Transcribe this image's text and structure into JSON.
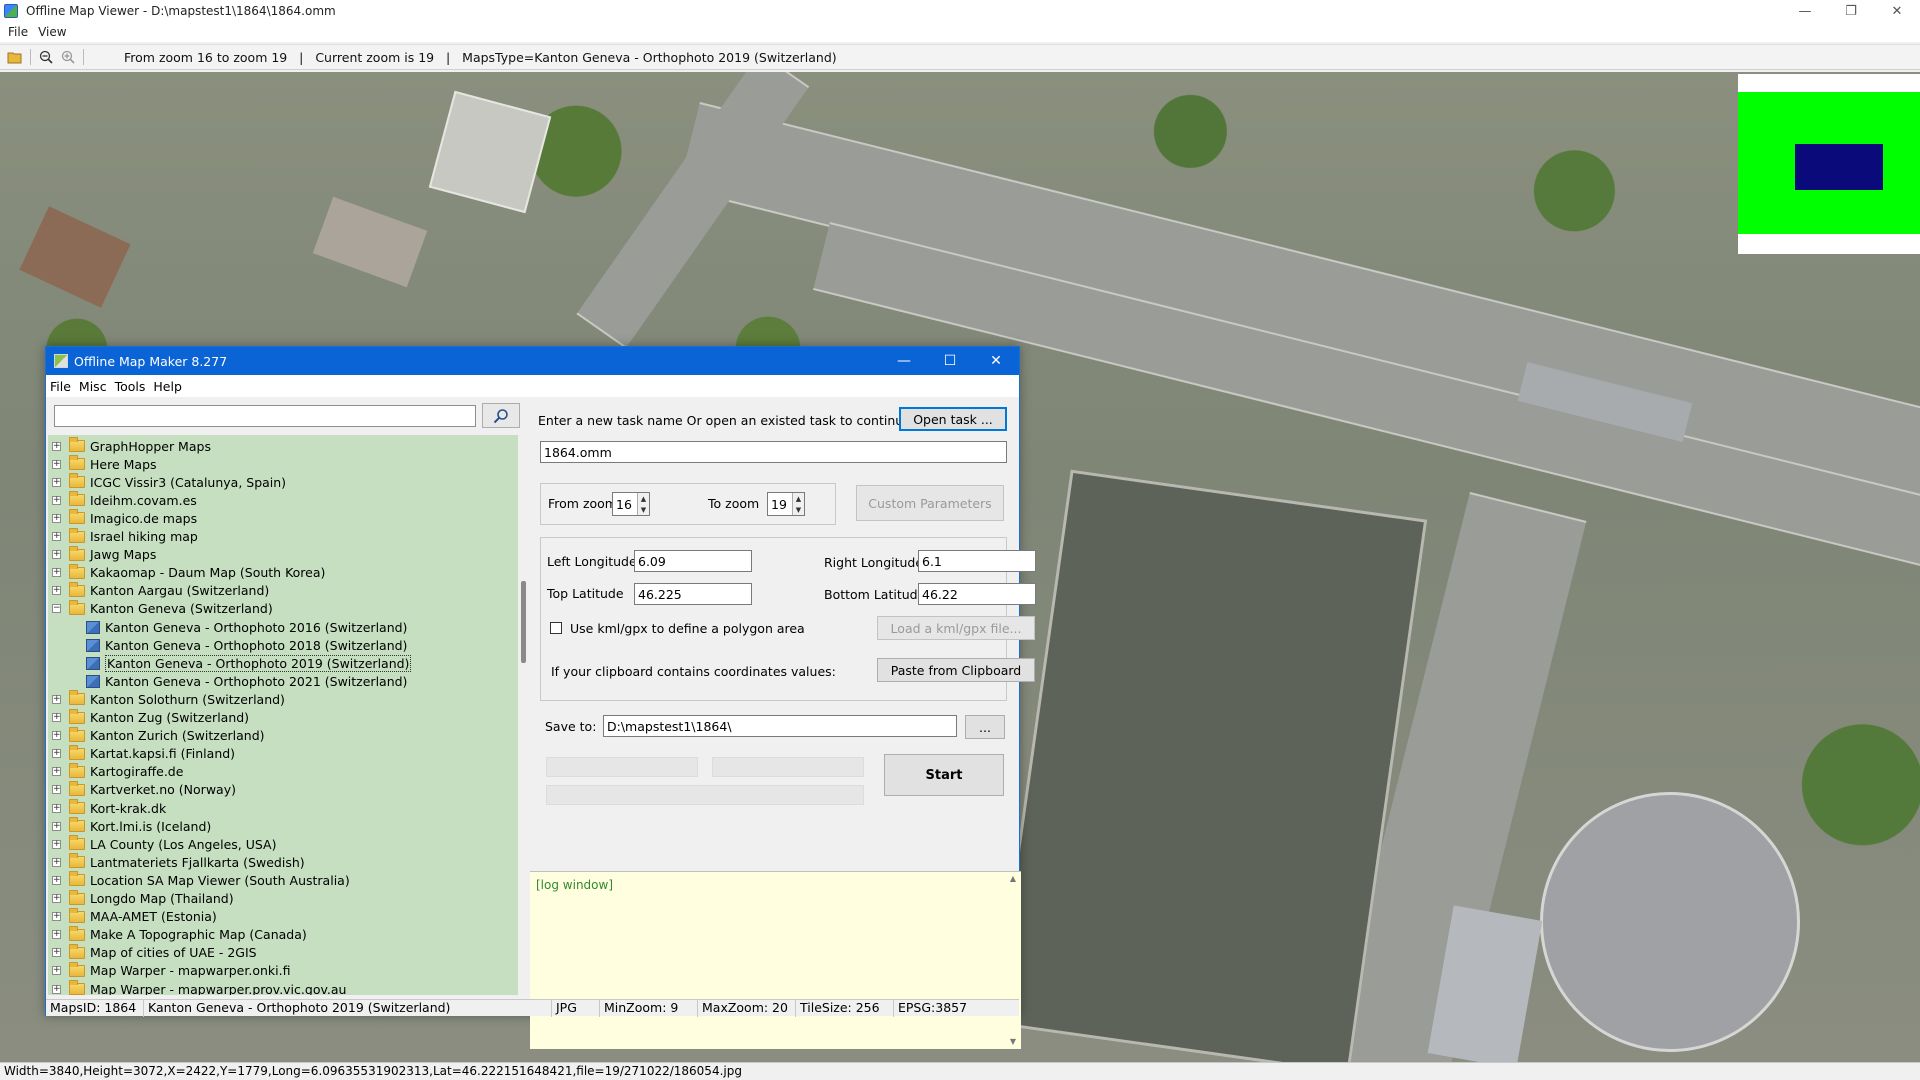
{
  "viewer": {
    "title": "Offline Map Viewer - D:\\mapstest1\\1864\\1864.omm",
    "menu": [
      "File",
      "View"
    ],
    "toolbar_status": "From zoom 16 to zoom 19   |   Current zoom is 19   |   MapsType=Kanton Geneva - Orthophoto 2019 (Switzerland)",
    "statusbar": "Width=3840,Height=3072,X=2422,Y=1779,Long=6.09635531902313,Lat=46.222151648421,file=19/271022/186054.jpg"
  },
  "dialog": {
    "title": "Offline Map Maker 8.277",
    "menu": [
      "File",
      "Misc",
      "Tools",
      "Help"
    ],
    "search_placeholder": "",
    "tree": [
      {
        "label": "GraphHopper Maps",
        "level": 0,
        "expanded": false
      },
      {
        "label": "Here Maps",
        "level": 0,
        "expanded": false
      },
      {
        "label": "ICGC Vissir3 (Catalunya, Spain)",
        "level": 0,
        "expanded": false
      },
      {
        "label": "Ideihm.covam.es",
        "level": 0,
        "expanded": false
      },
      {
        "label": "Imagico.de maps",
        "level": 0,
        "expanded": false
      },
      {
        "label": "Israel hiking map",
        "level": 0,
        "expanded": false
      },
      {
        "label": "Jawg Maps",
        "level": 0,
        "expanded": false
      },
      {
        "label": "Kakaomap - Daum Map (South Korea)",
        "level": 0,
        "expanded": false
      },
      {
        "label": "Kanton Aargau (Switzerland)",
        "level": 0,
        "expanded": false
      },
      {
        "label": "Kanton Geneva (Switzerland)",
        "level": 0,
        "expanded": true
      },
      {
        "label": "Kanton Geneva - Orthophoto 2016 (Switzerland)",
        "level": 1,
        "expanded": false
      },
      {
        "label": "Kanton Geneva - Orthophoto 2018 (Switzerland)",
        "level": 1,
        "expanded": false
      },
      {
        "label": "Kanton Geneva - Orthophoto 2019 (Switzerland)",
        "level": 1,
        "expanded": false,
        "selected": true
      },
      {
        "label": "Kanton Geneva - Orthophoto 2021 (Switzerland)",
        "level": 1,
        "expanded": false
      },
      {
        "label": "Kanton Solothurn (Switzerland)",
        "level": 0,
        "expanded": false
      },
      {
        "label": "Kanton Zug (Switzerland)",
        "level": 0,
        "expanded": false
      },
      {
        "label": "Kanton Zurich (Switzerland)",
        "level": 0,
        "expanded": false
      },
      {
        "label": "Kartat.kapsi.fi (Finland)",
        "level": 0,
        "expanded": false
      },
      {
        "label": "Kartogiraffe.de",
        "level": 0,
        "expanded": false
      },
      {
        "label": "Kartverket.no (Norway)",
        "level": 0,
        "expanded": false
      },
      {
        "label": "Kort-krak.dk",
        "level": 0,
        "expanded": false
      },
      {
        "label": "Kort.lmi.is (Iceland)",
        "level": 0,
        "expanded": false
      },
      {
        "label": "LA County (Los Angeles, USA)",
        "level": 0,
        "expanded": false
      },
      {
        "label": "Lantmateriets Fjallkarta (Swedish)",
        "level": 0,
        "expanded": false
      },
      {
        "label": "Location SA Map Viewer (South Australia)",
        "level": 0,
        "expanded": false
      },
      {
        "label": "Longdo Map (Thailand)",
        "level": 0,
        "expanded": false
      },
      {
        "label": "MAA-AMET (Estonia)",
        "level": 0,
        "expanded": false
      },
      {
        "label": "Make A Topographic Map (Canada)",
        "level": 0,
        "expanded": false
      },
      {
        "label": "Map of cities of UAE - 2GIS",
        "level": 0,
        "expanded": false
      },
      {
        "label": "Map Warper - mapwarper.onki.fi",
        "level": 0,
        "expanded": false
      },
      {
        "label": "Map Warper - mapwarper.prov.vic.gov.au",
        "level": 0,
        "expanded": false
      }
    ],
    "task_prompt": "Enter a new task name Or open an existed task to continue:",
    "open_task_label": "Open task ...",
    "task_name": "1864.omm",
    "from_zoom_label": "From zoom",
    "from_zoom": "16",
    "to_zoom_label": "To zoom",
    "to_zoom": "19",
    "custom_params_label": "Custom Parameters",
    "left_longitude_label": "Left Longitude",
    "left_longitude": "6.09",
    "right_longitude_label": "Right Longitude",
    "right_longitude": "6.1",
    "top_latitude_label": "Top Latitude",
    "top_latitude": "46.225",
    "bottom_latitude_label": "Bottom Latitude",
    "bottom_latitude": "46.22",
    "kml_checkbox_label": "Use kml/gpx to define a polygon area",
    "load_kml_label": "Load a kml/gpx file...",
    "clipboard_prompt": "If your clipboard contains coordinates values:",
    "paste_clipboard_label": "Paste from Clipboard",
    "save_to_label": "Save to:",
    "save_to": "D:\\mapstest1\\1864\\",
    "browse_label": "...",
    "start_label": "Start",
    "log_text": "[log window]",
    "status": {
      "maps_id": "MapsID: 1864",
      "maps_name": "Kanton Geneva - Orthophoto 2019 (Switzerland)",
      "format": "JPG",
      "min_zoom": "MinZoom: 9",
      "max_zoom": "MaxZoom: 20",
      "tile_size": "TileSize: 256",
      "epsg": "EPSG:3857"
    }
  },
  "colors": {
    "dialog_title_bg": "#0a64d6",
    "tree_bg": "#c5dfc0",
    "log_bg": "#ffffe0",
    "minimap_green": "#00ff00",
    "minimap_view": "#0a0a7a"
  }
}
